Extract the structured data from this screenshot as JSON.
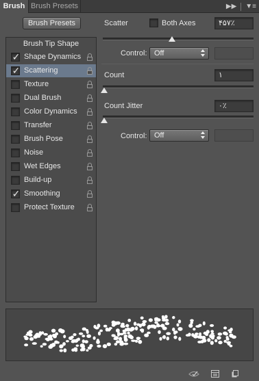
{
  "tabs": [
    {
      "label": "Brush",
      "active": true
    },
    {
      "label": "Brush Presets",
      "active": false
    }
  ],
  "toolbar": {
    "presets_button": "Brush Presets"
  },
  "sidebar": {
    "header": "Brush Tip Shape",
    "items": [
      {
        "label": "Shape Dynamics",
        "checked": true,
        "selected": false
      },
      {
        "label": "Scattering",
        "checked": true,
        "selected": true
      },
      {
        "label": "Texture",
        "checked": false,
        "selected": false
      },
      {
        "label": "Dual Brush",
        "checked": false,
        "selected": false
      },
      {
        "label": "Color Dynamics",
        "checked": false,
        "selected": false
      },
      {
        "label": "Transfer",
        "checked": false,
        "selected": false
      },
      {
        "label": "Brush Pose",
        "checked": false,
        "selected": false
      },
      {
        "label": "Noise",
        "checked": false,
        "selected": false
      },
      {
        "label": "Wet Edges",
        "checked": false,
        "selected": false
      },
      {
        "label": "Build-up",
        "checked": false,
        "selected": false
      },
      {
        "label": "Smoothing",
        "checked": true,
        "selected": false
      },
      {
        "label": "Protect Texture",
        "checked": false,
        "selected": false
      }
    ]
  },
  "scatter": {
    "label": "Scatter",
    "both_axes_label": "Both Axes",
    "both_axes_checked": false,
    "value": "۴۵۷٪",
    "level_fraction": 0.45,
    "control_label": "Control:",
    "control_value": "Off"
  },
  "count": {
    "label": "Count",
    "value": "۱",
    "level_fraction": 0.0
  },
  "count_jitter": {
    "label": "Count Jitter",
    "value": "۰٪",
    "level_fraction": 0.0,
    "control_label": "Control:",
    "control_value": "Off"
  },
  "icons": {
    "panel_menu": "panel-menu-icon",
    "collapse": "double-chevron-icon",
    "lock": "lock-icon",
    "preview_toggle": "eye-icon",
    "grid": "grid-icon",
    "new_preset": "new-document-icon"
  },
  "colors": {
    "panel_bg": "#535353",
    "selected_row": "#6b7a8d",
    "field_bg": "#3c3c3c"
  }
}
